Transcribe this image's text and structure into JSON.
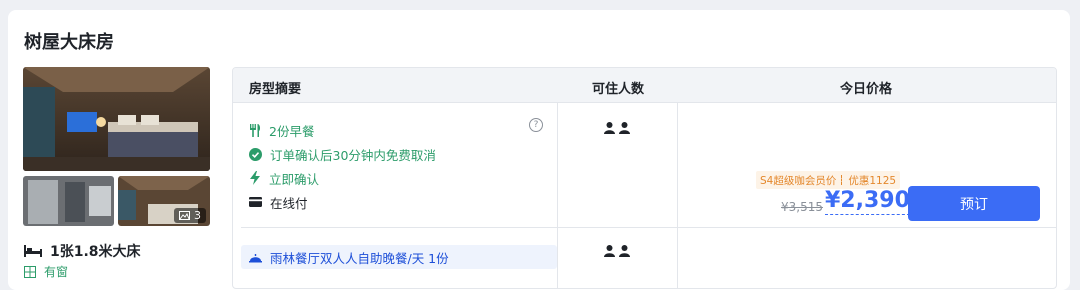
{
  "room": {
    "title": "树屋大床房",
    "photo_count": "3",
    "bed": "1张1.8米大床",
    "window": "有窗"
  },
  "table": {
    "headers": {
      "summary": "房型摘要",
      "occupancy": "可住人数",
      "price": "今日价格"
    },
    "rows": [
      {
        "features": [
          {
            "icon": "utensils-icon",
            "text": "2份早餐",
            "tone": "green"
          },
          {
            "icon": "check-circle-icon",
            "text": "订单确认后30分钟内免费取消",
            "tone": "green"
          },
          {
            "icon": "lightning-icon",
            "text": "立即确认",
            "tone": "green"
          },
          {
            "icon": "card-icon",
            "text": "在线付",
            "tone": "dark"
          }
        ],
        "guests": 2,
        "promo_member": "S4超级咖会员价",
        "promo_discount": "优惠1125",
        "old_price": "¥3,515",
        "price": "¥2,390",
        "book_label": "预订"
      },
      {
        "package": "雨林餐厅双人人自助晚餐/天 1份",
        "guests": 2
      }
    ]
  },
  "colors": {
    "accent": "#3b6cf5",
    "green": "#2c9c6a",
    "promo": "#e4882d"
  }
}
